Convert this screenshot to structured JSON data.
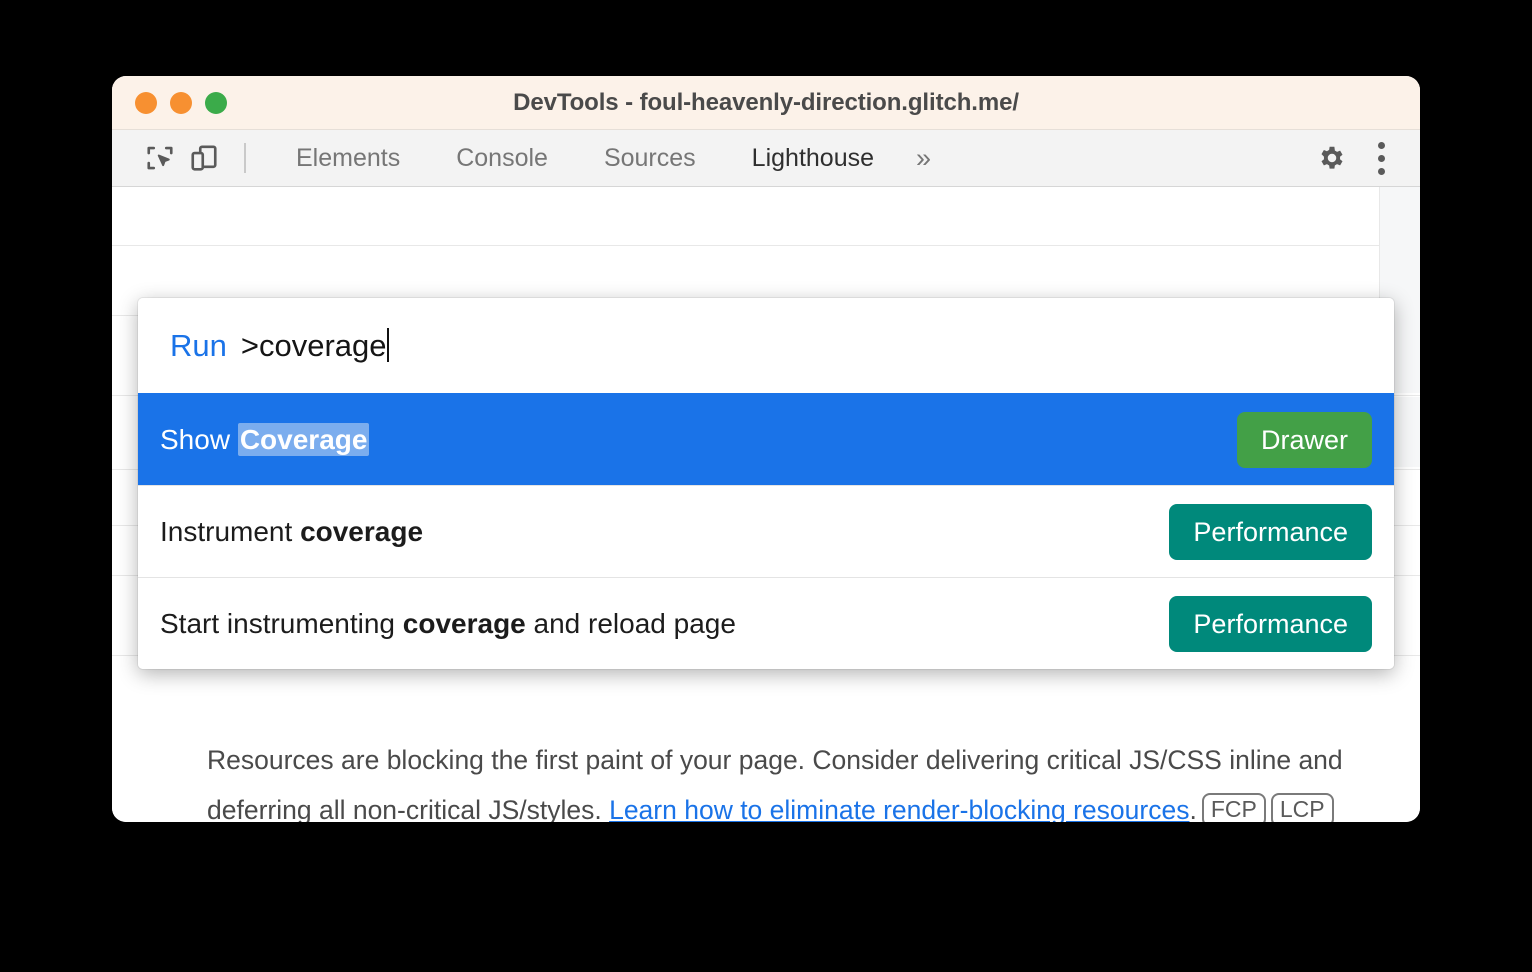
{
  "window": {
    "title": "DevTools - foul-heavenly-direction.glitch.me/",
    "traffic_lights": [
      {
        "name": "close",
        "color": "#f79031"
      },
      {
        "name": "minimize",
        "color": "#f79031"
      },
      {
        "name": "maximize",
        "color": "#3bab4a"
      }
    ]
  },
  "toolbar": {
    "inspect_icon": "inspect-element-icon",
    "device_icon": "device-toolbar-icon",
    "tabs": [
      {
        "label": "Elements",
        "active": false
      },
      {
        "label": "Console",
        "active": false
      },
      {
        "label": "Sources",
        "active": false
      },
      {
        "label": "Lighthouse",
        "active": true
      }
    ],
    "more_tabs_label": "»",
    "settings_icon": "gear-icon",
    "menu_icon": "kebab-menu-icon"
  },
  "command_palette": {
    "mode_label": "Run",
    "query_value": ">coverage",
    "query_placeholder": "Type a command",
    "results": [
      {
        "prefix": "Show ",
        "match": "Coverage",
        "suffix": "",
        "badge": "Drawer",
        "badge_color": "#43a047",
        "selected": true
      },
      {
        "prefix": "Instrument ",
        "match": "coverage",
        "suffix": "",
        "badge": "Performance",
        "badge_color": "#00897b",
        "selected": false
      },
      {
        "prefix": "Start instrumenting ",
        "match": "coverage",
        "suffix": " and reload page",
        "badge": "Performance",
        "badge_color": "#00897b",
        "selected": false
      }
    ]
  },
  "audit": {
    "text_part_1": "Resources are blocking the first paint of your page. Consider delivering critical JS/CSS inline and deferring all non-critical JS/styles. ",
    "link_text": "Learn how to eliminate render-blocking resources",
    "text_part_2": ".",
    "metrics": [
      {
        "label": "FCP"
      },
      {
        "label": "LCP"
      }
    ]
  }
}
